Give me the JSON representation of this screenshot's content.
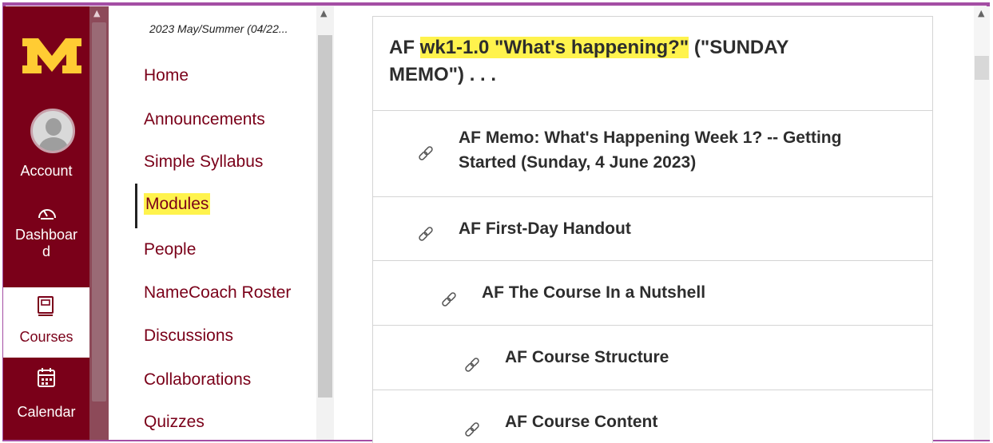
{
  "global_nav": {
    "logo": "university-m-logo",
    "account_label": "Account",
    "dashboard_label": "Dashboar d",
    "courses_label": "Courses",
    "calendar_label": "Calendar",
    "brand_color": "#7a0019"
  },
  "course_nav": {
    "term": "2023 May/Summer (04/22...",
    "items": [
      {
        "label": "Home"
      },
      {
        "label": "Announcements"
      },
      {
        "label": "Simple Syllabus"
      },
      {
        "label": "Modules",
        "active": true
      },
      {
        "label": "People"
      },
      {
        "label": "NameCoach Roster"
      },
      {
        "label": "Discussions"
      },
      {
        "label": "Collaborations"
      },
      {
        "label": "Quizzes"
      }
    ]
  },
  "module": {
    "title_prefix": "AF ",
    "title_highlight": "wk1-1.0 \"What's happening?\"",
    "title_suffix": " (\"SUNDAY MEMO\") . . .",
    "items": [
      {
        "icon": "link-icon",
        "label": "AF Memo: What's Happening Week 1? -- Getting Started (Sunday, 4 June 2023)"
      },
      {
        "icon": "link-icon",
        "label": "AF First-Day Handout"
      },
      {
        "icon": "link-icon",
        "label": "AF The Course In a Nutshell"
      },
      {
        "icon": "link-icon",
        "label": "AF Course Structure"
      },
      {
        "icon": "link-icon",
        "label": "AF Course Content"
      }
    ]
  },
  "colors": {
    "highlight": "#fff34d",
    "frame": "#a44ea4"
  }
}
